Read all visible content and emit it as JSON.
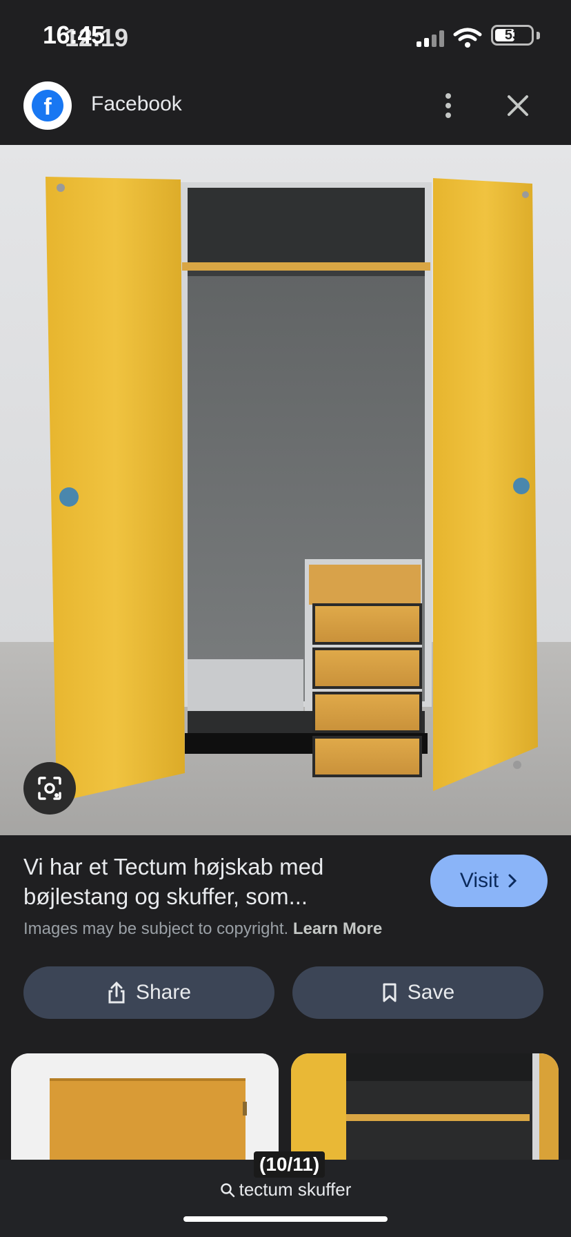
{
  "status_bar": {
    "time": "16:45",
    "time_overlay": "12:19",
    "battery": "53"
  },
  "header": {
    "app_name": "Facebook",
    "logo_letter": "f"
  },
  "result": {
    "caption": "Vi har et Tectum højskab med bøjlestang og skuffer, som...",
    "visit_label": "Visit",
    "copyright_text": "Images may be subject to copyright.",
    "learn_more": "Learn More"
  },
  "actions": {
    "share_label": "Share",
    "save_label": "Save"
  },
  "viewer": {
    "counter": "(10/11)",
    "query": "tectum skuffer"
  },
  "colors": {
    "background": "#1f1f21",
    "visit_button": "#8ab4f8",
    "action_button": "#3c4556"
  },
  "icons": [
    "facebook-logo",
    "more-vert-icon",
    "close-icon",
    "lens-icon",
    "chevron-right-icon",
    "share-icon",
    "bookmark-icon",
    "search-icon"
  ]
}
